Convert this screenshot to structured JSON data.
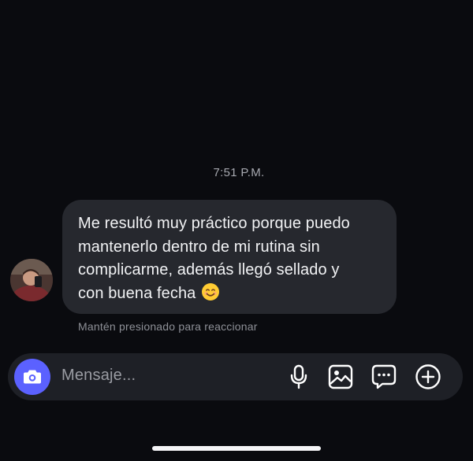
{
  "chat": {
    "timestamp": "7:51 P.M.",
    "message": {
      "text": "Me resultó muy práctico porque puedo\nmantenerlo dentro de mi rutina sin\ncomplicarme, además llegó sellado y\ncon buena fecha",
      "emoji": "smiling-face-icon"
    },
    "hint": "Mantén presionado para reaccionar"
  },
  "composer": {
    "placeholder": "Mensaje...",
    "camera_icon": "camera-icon",
    "camera_color": "#5b61ff",
    "actions": [
      "microphone-icon",
      "gallery-icon",
      "sticker-icon",
      "plus-circle-icon"
    ]
  },
  "colors": {
    "background": "#0a0b0f",
    "bubble": "#26282e",
    "composer": "#1e2026",
    "accent": "#5b61ff"
  }
}
